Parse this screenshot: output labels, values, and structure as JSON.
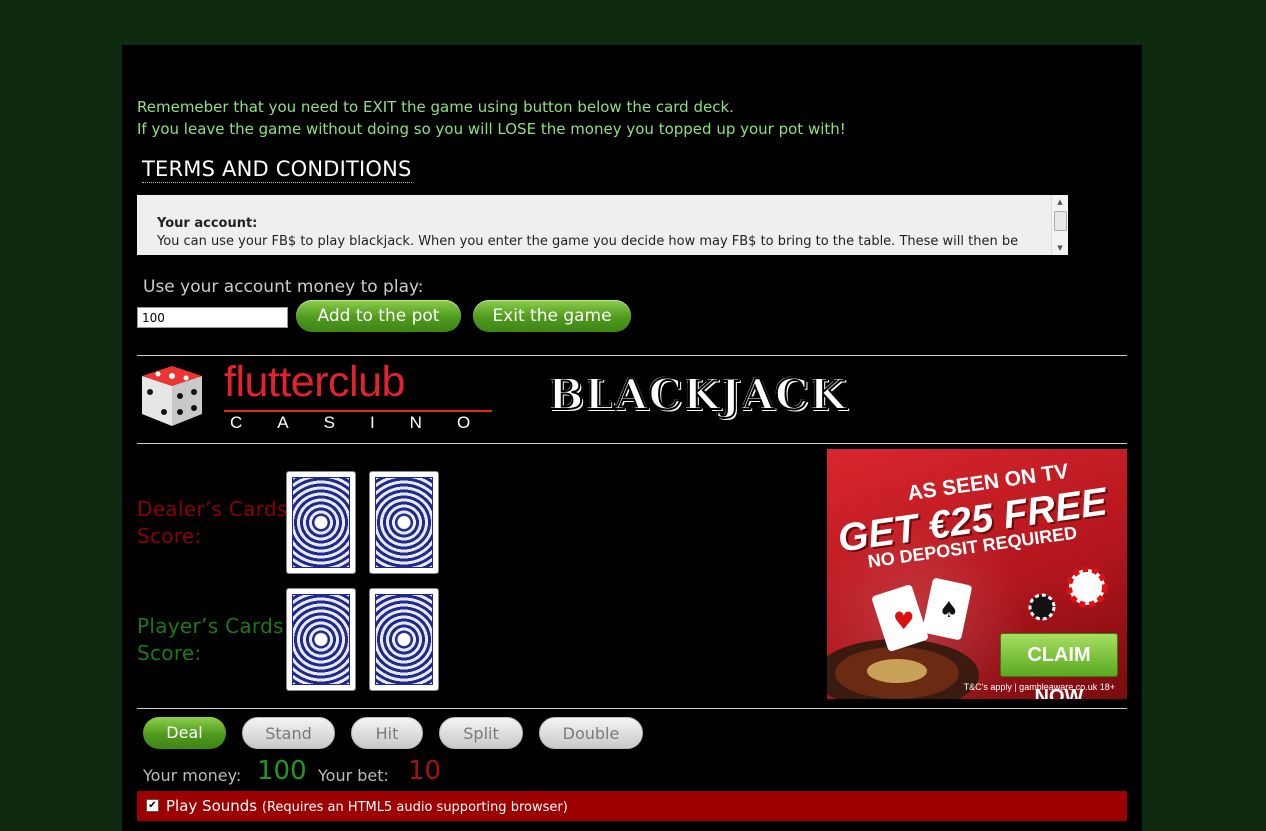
{
  "notices": {
    "line1": "Rememeber that you need to EXIT the game using button below the card deck.",
    "line2": "If you leave the game without doing so you will LOSE the money you topped up your pot with!"
  },
  "terms": {
    "heading": "TERMS AND CONDITIONS",
    "section_title": "Your account:",
    "section_text": "You can use your FB$ to play blackjack. When you enter the game you decide how may FB$ to bring to the table. These will then be"
  },
  "pot": {
    "label": "Use your account money to play:",
    "input_value": "100",
    "add_button": "Add to the pot",
    "exit_button": "Exit the game"
  },
  "brand": {
    "logo_text": "flutterclub",
    "logo_sub": "CASINO",
    "game_title": "BLACKJACK"
  },
  "table": {
    "dealer_label": "Dealer’s Cards",
    "dealer_score": "Score:",
    "player_label": "Player’s Cards",
    "player_score": "Score:"
  },
  "ad": {
    "line1": "AS SEEN ON TV",
    "line2": "GET €25 FREE",
    "line3": "NO DEPOSIT REQUIRED",
    "cta": "CLAIM NOW",
    "footer": "T&C's apply | gambleaware.co.uk 18+"
  },
  "actions": {
    "deal": "Deal",
    "stand": "Stand",
    "hit": "Hit",
    "split": "Split",
    "double": "Double"
  },
  "status": {
    "money_label": "Your money:",
    "money_value": "100",
    "bet_label": "Your bet:",
    "bet_value": "10"
  },
  "sound": {
    "label": "Play Sounds",
    "note": "(Requires an HTML5 audio supporting browser)",
    "checked": true
  },
  "colors": {
    "page_bg": "#0e2a0f",
    "notice_text": "#8ee07f",
    "dealer_red": "#8b0000",
    "player_green": "#1a7a1a",
    "button_green": "#4f9a1e",
    "sound_bar": "#9d0000"
  }
}
